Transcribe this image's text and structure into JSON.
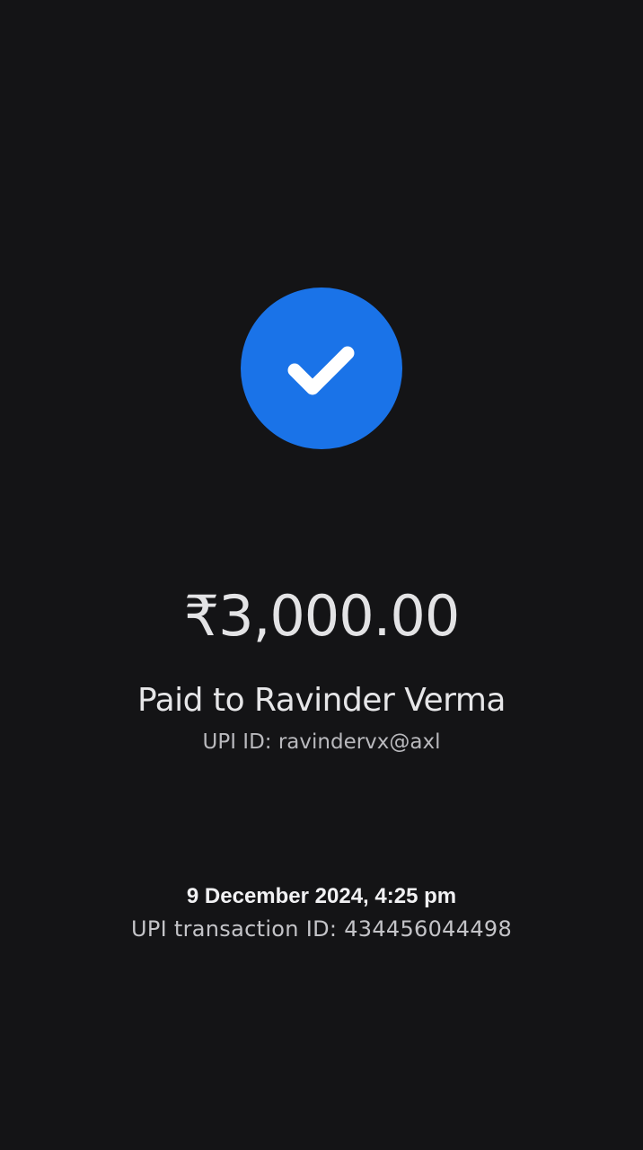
{
  "status": {
    "icon": "check-icon",
    "accent_color": "#1a73e8"
  },
  "payment": {
    "amount": "₹3,000.00",
    "paid_to": "Paid to Ravinder Verma",
    "upi_id": "UPI ID: ravindervx@axl"
  },
  "transaction": {
    "datetime": "9 December 2024, 4:25 pm",
    "upi_transaction_id": "UPI transaction ID: 434456044498"
  }
}
